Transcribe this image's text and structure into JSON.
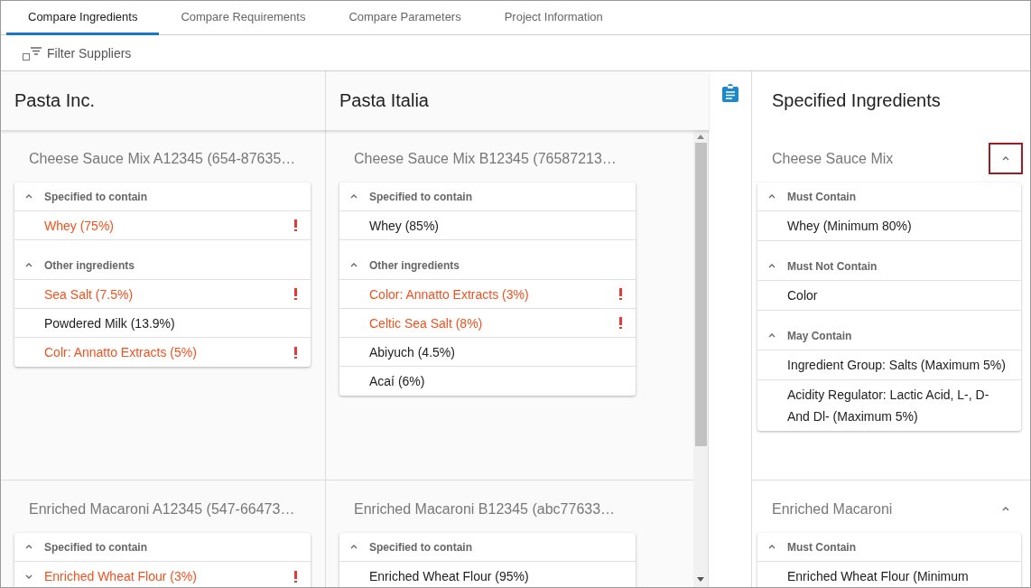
{
  "tabs": [
    {
      "label": "Compare Ingredients",
      "selected": true
    },
    {
      "label": "Compare Requirements",
      "selected": false
    },
    {
      "label": "Compare Parameters",
      "selected": false
    },
    {
      "label": "Project Information",
      "selected": false
    }
  ],
  "filter": {
    "label": "Filter Suppliers",
    "checked": false
  },
  "suppliers": [
    {
      "name": "Pasta Inc."
    },
    {
      "name": "Pasta Italia"
    }
  ],
  "product_rows": [
    {
      "products": [
        {
          "title": "Cheese Sauce Mix A12345 (654-87635…",
          "groups": [
            {
              "label": "Specified to contain",
              "expanded": true,
              "items": [
                {
                  "kind": "plain",
                  "text": "Whey (75%)",
                  "flagged": true
                }
              ]
            },
            {
              "label": "Other ingredients",
              "expanded": true,
              "items": [
                {
                  "kind": "plain",
                  "text": "Sea Salt (7.5%)",
                  "flagged": true
                },
                {
                  "kind": "plain",
                  "text": "Powdered Milk (13.9%)",
                  "flagged": false
                },
                {
                  "kind": "plain",
                  "text": "Colr: Annatto Extracts (5%)",
                  "flagged": true
                }
              ]
            }
          ]
        },
        {
          "title": "Cheese Sauce Mix B12345 (76587213…",
          "groups": [
            {
              "label": "Specified to contain",
              "expanded": true,
              "items": [
                {
                  "kind": "plain",
                  "text": "Whey (85%)",
                  "flagged": false
                }
              ]
            },
            {
              "label": "Other ingredients",
              "expanded": true,
              "items": [
                {
                  "kind": "plain",
                  "text": "Color: Annatto Extracts (3%)",
                  "flagged": true
                },
                {
                  "kind": "plain",
                  "text": "Celtic Sea Salt (8%)",
                  "flagged": true
                },
                {
                  "kind": "plain",
                  "text": "Abiyuch (4.5%)",
                  "flagged": false
                },
                {
                  "kind": "plain",
                  "text": "Acaí (6%)",
                  "flagged": false
                }
              ]
            }
          ]
        }
      ]
    },
    {
      "products": [
        {
          "title": "Enriched Macaroni A12345 (547-66473…",
          "groups": [
            {
              "label": "Specified to contain",
              "expanded": true,
              "items": [
                {
                  "kind": "expandable",
                  "text": "Enriched Wheat Flour (3%)",
                  "flagged": true,
                  "expanded": false
                }
              ]
            }
          ]
        },
        {
          "title": "Enriched Macaroni B12345 (abc77633…",
          "groups": [
            {
              "label": "Specified to contain",
              "expanded": true,
              "items": [
                {
                  "kind": "plain",
                  "text": "Enriched Wheat Flour (95%)",
                  "flagged": false
                }
              ]
            }
          ]
        }
      ]
    }
  ],
  "specified": {
    "title": "Specified Ingredients",
    "sections": [
      {
        "name": "Cheese Sauce Mix",
        "expanded": true,
        "highlighted": true,
        "groups": [
          {
            "label": "Must Contain",
            "expanded": true,
            "items": [
              "Whey (Minimum 80%)"
            ]
          },
          {
            "label": "Must Not Contain",
            "expanded": true,
            "items": [
              "Color"
            ]
          },
          {
            "label": "May Contain",
            "expanded": true,
            "items": [
              "Ingredient Group: Salts (Maximum 5%)",
              "Acidity Regulator: Lactic Acid, L-, D- And Dl- (Maximum 5%)"
            ]
          }
        ]
      },
      {
        "name": "Enriched Macaroni",
        "expanded": true,
        "highlighted": false,
        "groups": [
          {
            "label": "Must Contain",
            "expanded": true,
            "items": [
              "Enriched Wheat Flour (Minimum"
            ]
          }
        ]
      }
    ]
  }
}
